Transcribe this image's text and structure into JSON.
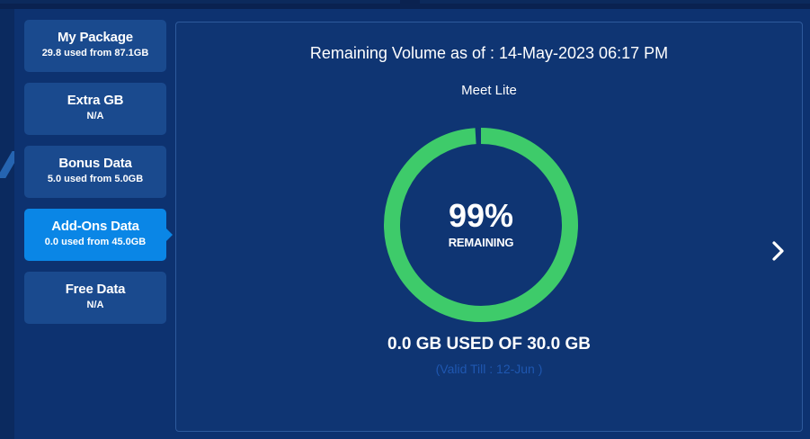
{
  "sidebar": {
    "tabs": [
      {
        "title": "My Package",
        "subtitle": "29.8 used from 87.1GB",
        "active": false
      },
      {
        "title": "Extra GB",
        "subtitle": "N/A",
        "active": false
      },
      {
        "title": "Bonus Data",
        "subtitle": "5.0 used from 5.0GB",
        "active": false
      },
      {
        "title": "Add-Ons Data",
        "subtitle": "0.0 used from 45.0GB",
        "active": true
      },
      {
        "title": "Free Data",
        "subtitle": "N/A",
        "active": false
      }
    ]
  },
  "main": {
    "remaining_title": "Remaining Volume as of : 14-May-2023 06:17 PM",
    "plan_name": "Meet Lite",
    "gauge": {
      "percent_text": "99%",
      "label": "REMAINING",
      "remaining_fraction": 0.99,
      "ring_color": "#3ecb6a"
    },
    "usage_text": "0.0 GB USED OF 30.0 GB",
    "valid_till": "(Valid Till : 12-Jun )",
    "next_icon": "chevron-right-icon"
  },
  "colors": {
    "background": "#0b2a5f",
    "panel": "#0d3270",
    "tab": "#1a4a8e",
    "tab_active": "#0a86e6",
    "accent_green": "#3ecb6a",
    "valid_text": "#1f57b0"
  }
}
